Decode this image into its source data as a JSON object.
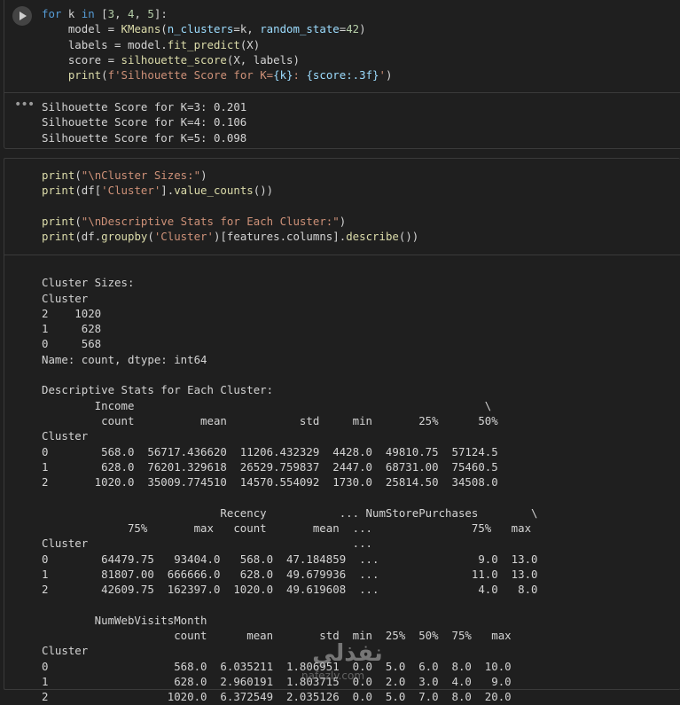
{
  "cell1": {
    "code_lines": [
      [
        {
          "t": "for",
          "c": "kw"
        },
        {
          "t": " k ",
          "c": "plain"
        },
        {
          "t": "in",
          "c": "kw"
        },
        {
          "t": " [",
          "c": "plain"
        },
        {
          "t": "3",
          "c": "num"
        },
        {
          "t": ", ",
          "c": "plain"
        },
        {
          "t": "4",
          "c": "num"
        },
        {
          "t": ", ",
          "c": "plain"
        },
        {
          "t": "5",
          "c": "num"
        },
        {
          "t": "]:",
          "c": "plain"
        }
      ],
      [
        {
          "t": "    model = ",
          "c": "plain"
        },
        {
          "t": "KMeans",
          "c": "fn"
        },
        {
          "t": "(",
          "c": "plain"
        },
        {
          "t": "n_clusters",
          "c": "var"
        },
        {
          "t": "=k, ",
          "c": "plain"
        },
        {
          "t": "random_state",
          "c": "var"
        },
        {
          "t": "=",
          "c": "plain"
        },
        {
          "t": "42",
          "c": "num"
        },
        {
          "t": ")",
          "c": "plain"
        }
      ],
      [
        {
          "t": "    labels = model.",
          "c": "plain"
        },
        {
          "t": "fit_predict",
          "c": "fn"
        },
        {
          "t": "(X)",
          "c": "plain"
        }
      ],
      [
        {
          "t": "    score = ",
          "c": "plain"
        },
        {
          "t": "silhouette_score",
          "c": "fn"
        },
        {
          "t": "(X, labels)",
          "c": "plain"
        }
      ],
      [
        {
          "t": "    ",
          "c": "plain"
        },
        {
          "t": "print",
          "c": "fn"
        },
        {
          "t": "(",
          "c": "plain"
        },
        {
          "t": "f'Silhouette Score for K=",
          "c": "str"
        },
        {
          "t": "{k}",
          "c": "var"
        },
        {
          "t": ": ",
          "c": "str"
        },
        {
          "t": "{score:.3f}",
          "c": "var"
        },
        {
          "t": "'",
          "c": "str"
        },
        {
          "t": ")",
          "c": "plain"
        }
      ]
    ],
    "output": "Silhouette Score for K=3: 0.201\nSilhouette Score for K=4: 0.106\nSilhouette Score for K=5: 0.098",
    "menu_icon": "ellipsis-icon"
  },
  "cell2": {
    "code_lines": [
      [
        {
          "t": "print",
          "c": "fn"
        },
        {
          "t": "(",
          "c": "plain"
        },
        {
          "t": "\"\\nCluster Sizes:\"",
          "c": "str"
        },
        {
          "t": ")",
          "c": "plain"
        }
      ],
      [
        {
          "t": "print",
          "c": "fn"
        },
        {
          "t": "(df[",
          "c": "plain"
        },
        {
          "t": "'Cluster'",
          "c": "str"
        },
        {
          "t": "].",
          "c": "plain"
        },
        {
          "t": "value_counts",
          "c": "fn"
        },
        {
          "t": "())",
          "c": "plain"
        }
      ],
      [
        {
          "t": "",
          "c": "plain"
        }
      ],
      [
        {
          "t": "print",
          "c": "fn"
        },
        {
          "t": "(",
          "c": "plain"
        },
        {
          "t": "\"\\nDescriptive Stats for Each Cluster:\"",
          "c": "str"
        },
        {
          "t": ")",
          "c": "plain"
        }
      ],
      [
        {
          "t": "print",
          "c": "fn"
        },
        {
          "t": "(df.",
          "c": "plain"
        },
        {
          "t": "groupby",
          "c": "fn"
        },
        {
          "t": "(",
          "c": "plain"
        },
        {
          "t": "'Cluster'",
          "c": "str"
        },
        {
          "t": ")[features.columns].",
          "c": "plain"
        },
        {
          "t": "describe",
          "c": "fn"
        },
        {
          "t": "())",
          "c": "plain"
        }
      ]
    ],
    "output": "\nCluster Sizes:\nCluster\n2    1020\n1     628\n0     568\nName: count, dtype: int64\n\nDescriptive Stats for Each Cluster:\n        Income                                                     \\\n         count          mean           std     min       25%      50%\nCluster\n0        568.0  56717.436620  11206.432329  4428.0  49810.75  57124.5\n1        628.0  76201.329618  26529.759837  2447.0  68731.00  75460.5\n2       1020.0  35009.774510  14570.554092  1730.0  25814.50  34508.0\n\n                           Recency           ... NumStorePurchases        \\\n             75%       max   count       mean  ...               75%   max\nCluster                                        ...\n0        64479.75   93404.0   568.0  47.184859  ...               9.0  13.0\n1        81807.00  666666.0   628.0  49.679936  ...              11.0  13.0\n2        42609.75  162397.0  1020.0  49.619608  ...               4.0   8.0\n\n        NumWebVisitsMonth\n                    count      mean       std  min  25%  50%  75%   max\nCluster\n0                   568.0  6.035211  1.806951  0.0  5.0  6.0  8.0  10.0\n1                   628.0  2.960191  1.803715  0.0  2.0  3.0  4.0   9.0\n2                  1020.0  6.372549  2.035126  0.0  5.0  7.0  8.0  20.0"
  },
  "watermark": {
    "logo_text": "نفذلي",
    "site_text": "nafezly.com"
  }
}
